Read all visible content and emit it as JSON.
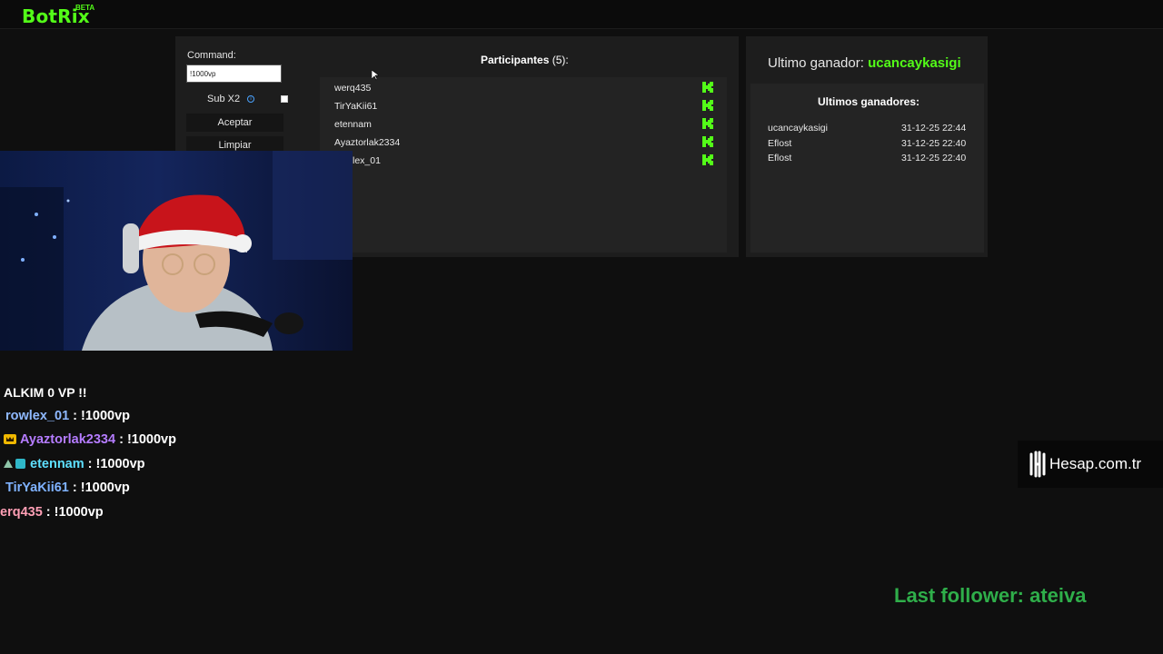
{
  "app": {
    "logo": "BotRix",
    "beta": "BETA"
  },
  "form": {
    "command_label": "Command:",
    "command_value": "!1000vp",
    "subx2_label": "Sub X2",
    "accept_label": "Aceptar",
    "clear_label": "Limpiar"
  },
  "participants": {
    "title": "Participantes",
    "count": "(5):",
    "items": [
      "werq435",
      "TirYaKii61",
      "etennam",
      "Ayaztorlak2334",
      "lex_01"
    ]
  },
  "winners": {
    "last_label": "Ultimo ganador:",
    "last_name": "ucancaykasigi",
    "title": "Ultimos ganadores:",
    "rows": [
      {
        "name": "ucancaykasigi",
        "time": "31-12-25 22:44"
      },
      {
        "name": "Eflost",
        "time": "31-12-25 22:40"
      },
      {
        "name": "Eflost",
        "time": "31-12-25 22:40"
      }
    ]
  },
  "chat": {
    "cut_line": "ALKIM 0 VP !!",
    "messages": [
      {
        "user": "rowlex_01",
        "sep": " : ",
        "text": "!1000vp"
      },
      {
        "user": "Ayaztorlak2334",
        "sep": " : ",
        "text": "!1000vp"
      },
      {
        "user": "etennam",
        "sep": " : ",
        "text": "!1000vp"
      },
      {
        "user": "TirYaKii61",
        "sep": " : ",
        "text": "!1000vp"
      },
      {
        "user": "erq435",
        "sep": " : ",
        "text": "!1000vp"
      }
    ]
  },
  "overlay": {
    "hesap_text": "Hesap.com.tr",
    "last_follower": "Last follower: ateiva"
  },
  "colors": {
    "accent": "#53fc18",
    "follower": "#2fae4a"
  }
}
